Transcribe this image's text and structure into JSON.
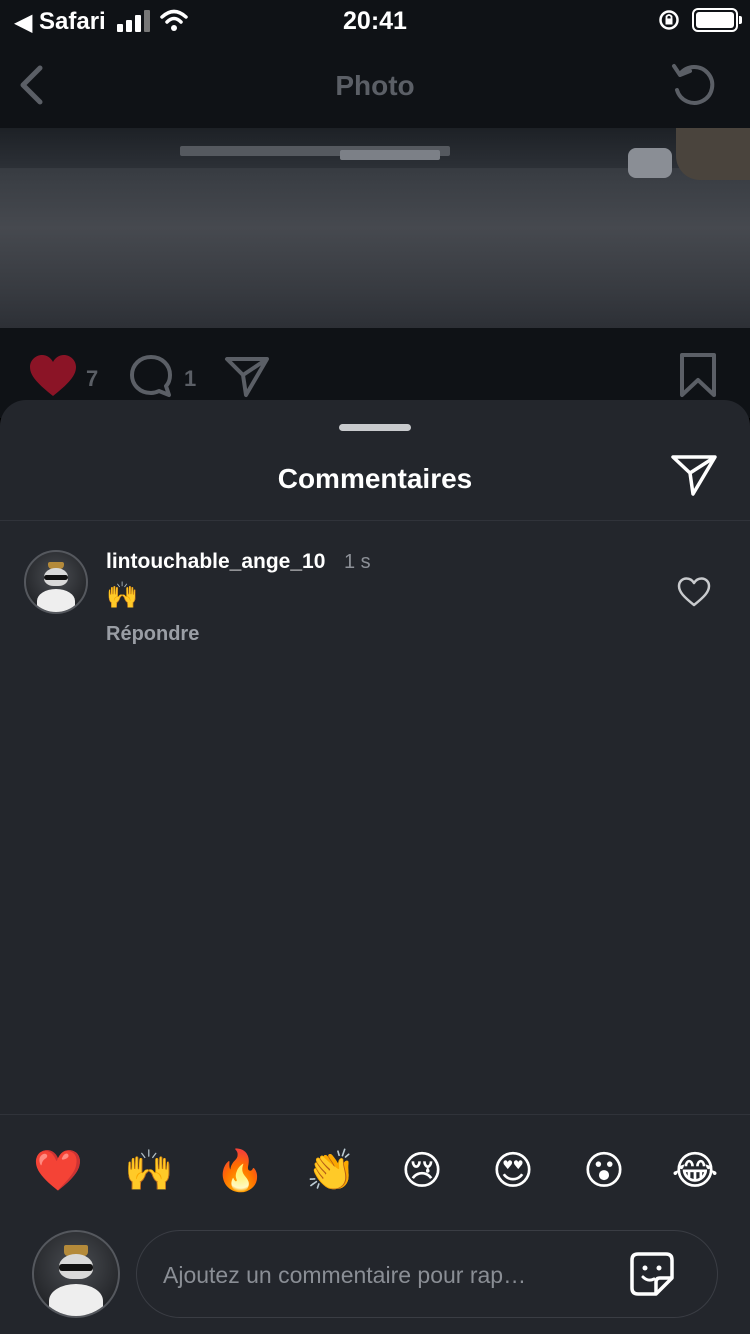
{
  "status_bar": {
    "back_arrow": "◀",
    "carrier": "Safari",
    "time": "20:41",
    "icons": [
      "signal-icon",
      "wifi-icon",
      "orientation-lock-icon",
      "battery-icon"
    ]
  },
  "nav": {
    "title": "Photo",
    "back_icon": "chevron-left-icon",
    "refresh_icon": "refresh-icon"
  },
  "post": {
    "likes": "7",
    "comments": "1",
    "liked": true,
    "like_color": "#8b1426"
  },
  "sheet": {
    "title": "Commentaires",
    "share_icon": "paper-plane-icon"
  },
  "comments": [
    {
      "username": "lintouchable_ange_10",
      "time": "1 s",
      "text": "🙌",
      "reply_label": "Répondre"
    }
  ],
  "quick_reactions": [
    "❤️",
    "🙌",
    "🔥",
    "👏",
    "😢",
    "😍",
    "😮",
    "😂"
  ],
  "composer": {
    "placeholder": "Ajoutez un commentaire pour rap…",
    "value": ""
  },
  "colors": {
    "background": "#0f1216",
    "sheet": "#23262c",
    "muted_text": "#8c9097"
  }
}
